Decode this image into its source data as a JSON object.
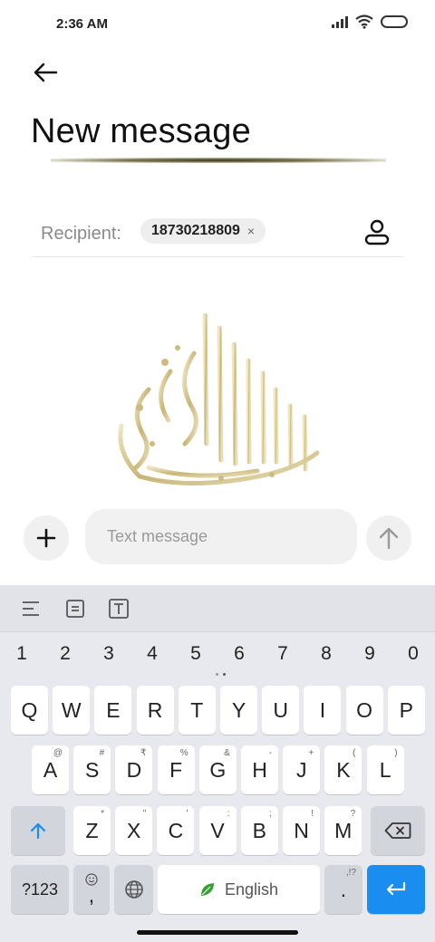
{
  "status_bar": {
    "time": "2:36 AM",
    "icons": [
      "signal-icon",
      "wifi-icon",
      "battery-icon"
    ]
  },
  "header": {
    "back_icon": "arrow-left-icon",
    "title": "New message"
  },
  "recipient": {
    "label": "Recipient:",
    "chip_number": "18730218809",
    "chip_remove": "×",
    "contact_icon": "person-icon"
  },
  "compose": {
    "attach_icon": "plus-icon",
    "placeholder": "Text message",
    "value": "",
    "send_icon": "arrow-up-icon"
  },
  "keyboard": {
    "toolbar_icons": [
      "align-icon",
      "clipboard-icon",
      "text-icon"
    ],
    "numbers": [
      "1",
      "2",
      "3",
      "4",
      "5",
      "6",
      "7",
      "8",
      "9",
      "0"
    ],
    "row1": [
      {
        "k": "Q",
        "s": ""
      },
      {
        "k": "W",
        "s": ""
      },
      {
        "k": "E",
        "s": ""
      },
      {
        "k": "R",
        "s": ""
      },
      {
        "k": "T",
        "s": ""
      },
      {
        "k": "Y",
        "s": ""
      },
      {
        "k": "U",
        "s": ""
      },
      {
        "k": "I",
        "s": ""
      },
      {
        "k": "O",
        "s": ""
      },
      {
        "k": "P",
        "s": ""
      }
    ],
    "row2": [
      {
        "k": "A",
        "s": "@"
      },
      {
        "k": "S",
        "s": "#"
      },
      {
        "k": "D",
        "s": "₹"
      },
      {
        "k": "F",
        "s": "%"
      },
      {
        "k": "G",
        "s": "&"
      },
      {
        "k": "H",
        "s": "-"
      },
      {
        "k": "J",
        "s": "+"
      },
      {
        "k": "K",
        "s": "("
      },
      {
        "k": "L",
        "s": ")"
      }
    ],
    "row3": [
      {
        "k": "Z",
        "s": "*"
      },
      {
        "k": "X",
        "s": "\""
      },
      {
        "k": "C",
        "s": "'"
      },
      {
        "k": "V",
        "s": ":"
      },
      {
        "k": "B",
        "s": ";"
      },
      {
        "k": "N",
        "s": "!"
      },
      {
        "k": "M",
        "s": "?"
      }
    ],
    "symbols_label": "?123",
    "comma": ",",
    "space_label": "English",
    "period": ".",
    "period_sub": ",!?",
    "colors": {
      "enter": "#1a8ef0",
      "shift_arrow": "#1a8ef0",
      "leaf": "#3aa035"
    }
  }
}
